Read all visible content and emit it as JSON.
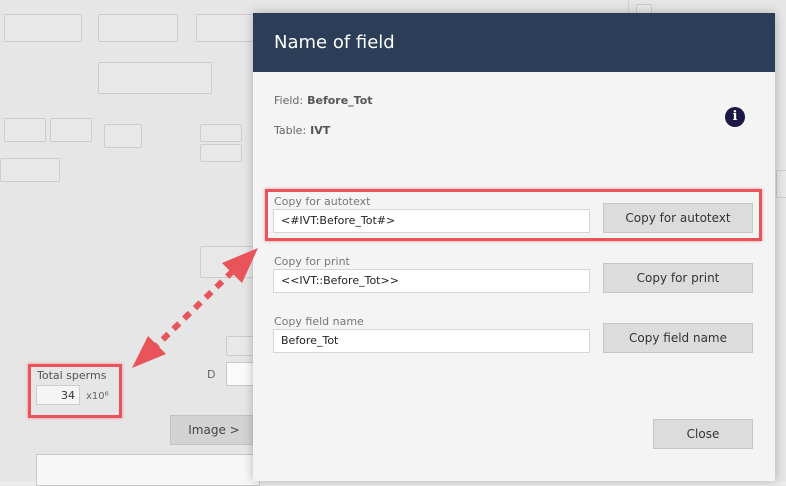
{
  "background": {
    "total_sperms_label": "Total sperms",
    "total_sperms_value": "34",
    "total_sperms_unit": "x10⁶",
    "image_button_label": "Image >",
    "d_label": "D"
  },
  "dialog": {
    "title": "Name of field",
    "field_label": "Field:",
    "field_value": "Before_Tot",
    "table_label": "Table:",
    "table_value": "IVT",
    "info_icon_glyph": "i",
    "rows": [
      {
        "label": "Copy for autotext",
        "value": "<#IVT:Before_Tot#>",
        "button": "Copy for autotext"
      },
      {
        "label": "Copy for print",
        "value": "<<IVT::Before_Tot>>",
        "button": "Copy for print"
      },
      {
        "label": "Copy field name",
        "value": "Before_Tot",
        "button": "Copy field name"
      }
    ],
    "close_label": "Close"
  },
  "colors": {
    "header": "#2b3d57",
    "highlight": "#e8545a",
    "info_icon": "#1c1846"
  },
  "icons": {
    "info": "info-icon",
    "arrow": "double-headed-dotted-arrow-icon"
  }
}
